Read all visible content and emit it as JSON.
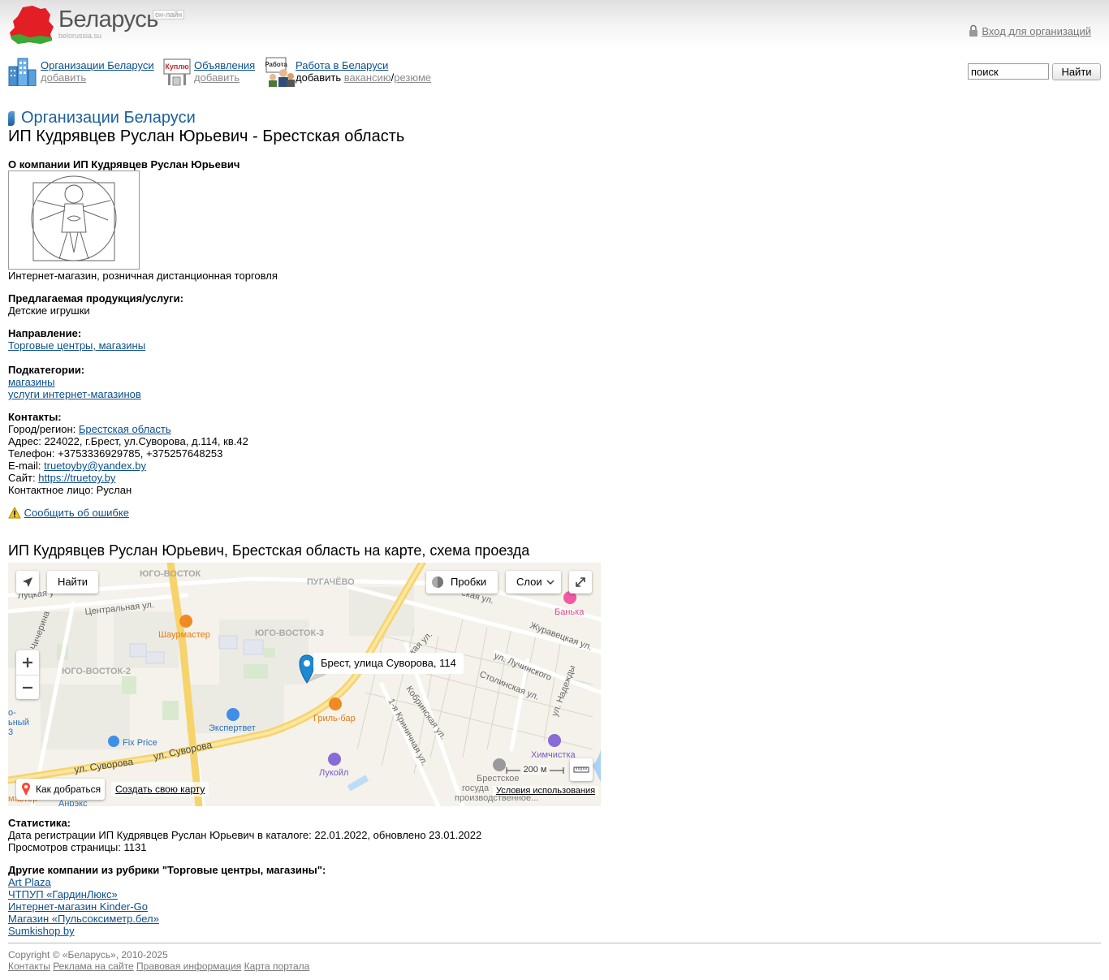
{
  "header": {
    "logo_name": "Беларусь",
    "logo_online": "он-лайн",
    "logo_domain": "belorussia.su",
    "login_link": "Вход для организаций"
  },
  "nav": {
    "orgs": {
      "title": "Организации Беларуси",
      "add": "добавить"
    },
    "ads": {
      "title": "Объявления",
      "add": "добавить",
      "icon_text": "Куплю"
    },
    "jobs": {
      "title": "Работа в Беларуси",
      "add": "добавить",
      "vacancy": "вакансию",
      "sep": "/",
      "resume": "резюме",
      "icon_text": "Работа"
    }
  },
  "search": {
    "value": "поиск",
    "button": "Найти"
  },
  "breadcrumb": "Организации Беларуси",
  "page_title": "ИП Кудрявцев Руслан Юрьевич - Брестская область",
  "about": {
    "heading": "О компании ИП Кудрявцев Руслан Юрьевич",
    "description": "Интернет-магазин, розничная дистанционная торговля"
  },
  "products": {
    "label": "Предлагаемая продукция/услуги:",
    "value": "Детские игрушки"
  },
  "direction": {
    "label": "Направление:",
    "link": "Торговые центры, магазины"
  },
  "subcategories": {
    "label": "Подкатегории:",
    "items": [
      "магазины",
      "услуги интернет-магазинов"
    ]
  },
  "contacts": {
    "label": "Контакты:",
    "city_label": "Город/регион: ",
    "city_link": "Брестская область",
    "address": "Адрес: 224022, г.Брест, ул.Суворова, д.114, кв.42",
    "phone": "Телефон: +3753336929785, +375257648253",
    "email_label": "E-mail: ",
    "email": "truetoyby@yandex.by",
    "site_label": "Сайт: ",
    "site": "https://truetoy.by",
    "person": "Контактное лицо: Руслан"
  },
  "report_error": "Сообщить об ошибке",
  "map": {
    "title": "ИП Кудрявцев Руслан Юрьевич, Брестская область на карте, схема проезда",
    "find_btn": "Найти",
    "traffic_btn": "Пробки",
    "layers_btn": "Слои",
    "marker_label": "Брест, улица Суворова, 114",
    "route_btn": "Как добраться",
    "create_map": "Создать свою карту",
    "terms": "Условия использования",
    "scale": "200 м",
    "labels": {
      "d1": "ЮГО-ВОСТОК",
      "d2": "ПУГАЧЁВО",
      "d3": "ЮГО-ВОСТОК-3",
      "d4": "ЮГО-ВОСТОК-2",
      "s1": "Луцкая у",
      "s2": "Центральная ул.",
      "s3": "Чичерина",
      "s4": "ул. Суворова",
      "s5": "ул. Суворова",
      "s6": "Журавецкая ул.",
      "s7": "ул. Лучинского",
      "s8": "Столинская ул.",
      "s9": "Кобринская ул.",
      "s10": "1-я Криничная ул.",
      "s11": "ул. Надежды",
      "s12": "ская ул.",
      "s13": "окая ул.",
      "p1": "Шаурмастер",
      "p2": "Экспертвет",
      "p3": "Гриль-бар",
      "p4": "Fix Price",
      "p5": "Лукойл",
      "p6": "Банька",
      "p7": "Химчистка",
      "p8": "Брестское",
      "p9": "госуда",
      "p10": "производственное...",
      "p11": "о-",
      "p12": "ьный",
      "p13": "3",
      "p14": "Анрэкс",
      "p15": "мастер"
    }
  },
  "stats": {
    "label": "Статистика:",
    "registered": "Дата регистрации ИП Кудрявцев Руслан Юрьевич в каталоге: 22.01.2022, обновлено 23.01.2022",
    "views": "Просмотров страницы: 1131"
  },
  "other": {
    "label": "Другие компании из рубрики \"Торговые центры, магазины\":",
    "items": [
      "Art Plaza",
      "ЧТПУП «ГардинЛюкс»",
      "Интернет-магазин Kinder-Go",
      "Магазин «Пульсоксиметр.бел»",
      "Sumkishop by"
    ]
  },
  "footer": {
    "copyright": "Copyright © «Беларусь», 2010-2025",
    "links": [
      "Контакты",
      "Реклама на сайте",
      "Правовая информация",
      "Карта портала"
    ]
  },
  "colors": {
    "link": "#0b4f8c",
    "breadcrumb": "#1c5f99",
    "map_marker": "#1e88d2",
    "poi_orange": "#f08a24",
    "poi_blue": "#3f8ee8",
    "poi_purple": "#8a6ad6"
  }
}
